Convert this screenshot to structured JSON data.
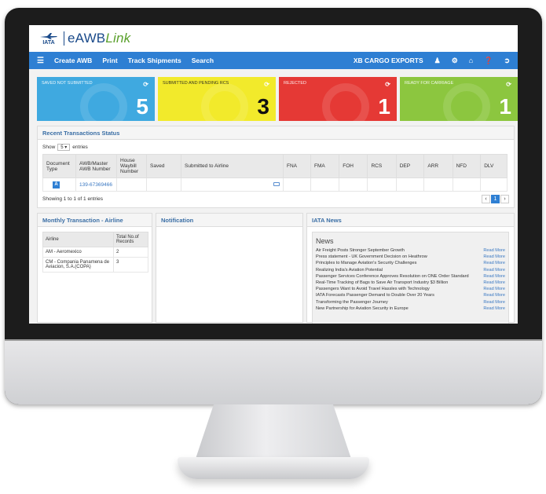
{
  "app": {
    "logo_mark": "IATA",
    "logo_prefix": "eAWB",
    "logo_suffix": "Link"
  },
  "nav": {
    "items": [
      "Create AWB",
      "Print",
      "Track Shipments",
      "Search"
    ],
    "account": "XB CARGO EXPORTS"
  },
  "tiles": [
    {
      "title": "SAVED NOT SUBMITTED",
      "count": "5",
      "color": "#3fa9e0"
    },
    {
      "title": "SUBMITTED AND PENDING RCS",
      "count": "3",
      "color": "#f2ea2b"
    },
    {
      "title": "REJECTED",
      "count": "1",
      "color": "#e53935"
    },
    {
      "title": "READY FOR CARRIAGE",
      "count": "1",
      "color": "#8cc63f"
    }
  ],
  "recent": {
    "title": "Recent Transactions Status",
    "show_label": "Show",
    "entries_value": "5",
    "entries_label": "entries",
    "columns": [
      "Document Type",
      "AWB/Master AWB Number",
      "House Waybill Number",
      "Saved",
      "Submitted to Airline",
      "FNA",
      "FMA",
      "FOH",
      "RCS",
      "DEP",
      "ARR",
      "NFD",
      "DLV"
    ],
    "rows": [
      {
        "doc": "A",
        "awb": "139-67369466"
      }
    ],
    "showing": "Showing 1 to 1 of 1 entries",
    "page": "1"
  },
  "monthly": {
    "title": "Monthly Transaction - Airline",
    "col_airline": "Airline",
    "col_total": "Total No.of Records",
    "rows": [
      {
        "airline": "AM - Aeromexico",
        "total": "2"
      },
      {
        "airline": "CM - Compania Panamena de Aviacion, S.A.(COPA)",
        "total": "3"
      }
    ]
  },
  "notification": {
    "title": "Notification"
  },
  "news": {
    "title": "IATA News",
    "box_title": "News",
    "read_more": "Read More",
    "items": [
      "Air Freight Posts Stronger September Growth",
      "Press statement - UK Government Decision on Heathrow",
      "Principles to Manage Aviation's Security Challenges",
      "Realizing India's Aviation Potential",
      "Passenger Services Conference Approves Resolution on ONE Order Standard",
      "Real-Time Tracking of Bags to Save Air Transport Industry $3 Billion",
      "Passengers Want to Avoid Travel Hassles with Technology",
      "IATA Forecasts Passenger Demand to Double Over 20 Years",
      "Transforming the Passenger Journey",
      "New Partnership for Aviation Security in Europe"
    ]
  }
}
